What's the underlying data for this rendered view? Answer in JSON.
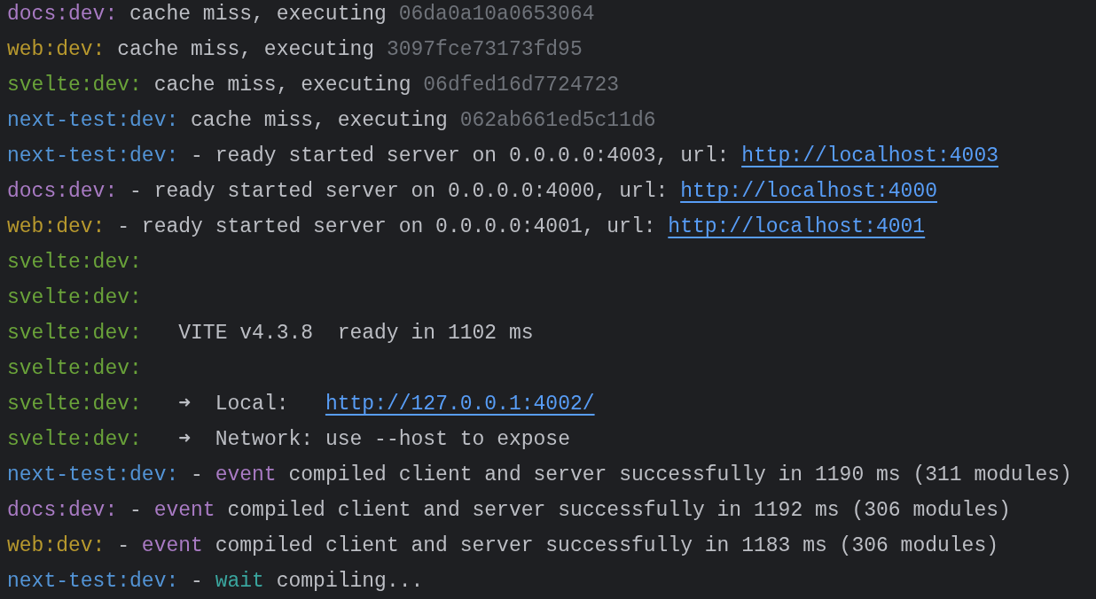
{
  "lines": [
    {
      "segments": [
        {
          "kind": "prefix",
          "text": "docs:dev:",
          "color": "#a97bc4"
        },
        {
          "kind": "text",
          "text": " cache miss, executing "
        },
        {
          "kind": "hash",
          "text": "06da0a10a0653064"
        }
      ]
    },
    {
      "segments": [
        {
          "kind": "prefix",
          "text": "web:dev:",
          "color": "#b8992e"
        },
        {
          "kind": "text",
          "text": " cache miss, executing "
        },
        {
          "kind": "hash",
          "text": "3097fce73173fd95"
        }
      ]
    },
    {
      "segments": [
        {
          "kind": "prefix",
          "text": "svelte:dev:",
          "color": "#6aa33a"
        },
        {
          "kind": "text",
          "text": " cache miss, executing "
        },
        {
          "kind": "hash",
          "text": "06dfed16d7724723"
        }
      ]
    },
    {
      "segments": [
        {
          "kind": "prefix",
          "text": "next-test:dev:",
          "color": "#5394d6"
        },
        {
          "kind": "text",
          "text": " cache miss, executing "
        },
        {
          "kind": "hash",
          "text": "062ab661ed5c11d6"
        }
      ]
    },
    {
      "segments": [
        {
          "kind": "prefix",
          "text": "next-test:dev:",
          "color": "#5394d6"
        },
        {
          "kind": "text",
          "text": " - ready started server on 0.0.0.0:4003, url: "
        },
        {
          "kind": "link",
          "text": "http://localhost:4003"
        }
      ]
    },
    {
      "segments": [
        {
          "kind": "prefix",
          "text": "docs:dev:",
          "color": "#a97bc4"
        },
        {
          "kind": "text",
          "text": " - ready started server on 0.0.0.0:4000, url: "
        },
        {
          "kind": "link",
          "text": "http://localhost:4000"
        }
      ]
    },
    {
      "segments": [
        {
          "kind": "prefix",
          "text": "web:dev:",
          "color": "#b8992e"
        },
        {
          "kind": "text",
          "text": " - ready started server on 0.0.0.0:4001, url: "
        },
        {
          "kind": "link",
          "text": "http://localhost:4001"
        }
      ]
    },
    {
      "segments": [
        {
          "kind": "prefix",
          "text": "svelte:dev:",
          "color": "#6aa33a"
        }
      ]
    },
    {
      "segments": [
        {
          "kind": "prefix",
          "text": "svelte:dev:",
          "color": "#6aa33a"
        }
      ]
    },
    {
      "segments": [
        {
          "kind": "prefix",
          "text": "svelte:dev:",
          "color": "#6aa33a"
        },
        {
          "kind": "text",
          "text": "   VITE v4.3.8  ready in 1102 ms"
        }
      ]
    },
    {
      "segments": [
        {
          "kind": "prefix",
          "text": "svelte:dev:",
          "color": "#6aa33a"
        }
      ]
    },
    {
      "segments": [
        {
          "kind": "prefix",
          "text": "svelte:dev:",
          "color": "#6aa33a"
        },
        {
          "kind": "text",
          "text": "   ➜  Local:   "
        },
        {
          "kind": "link",
          "text": "http://127.0.0.1:4002/"
        }
      ]
    },
    {
      "segments": [
        {
          "kind": "prefix",
          "text": "svelte:dev:",
          "color": "#6aa33a"
        },
        {
          "kind": "text",
          "text": "   ➜  Network: use --host to expose"
        }
      ]
    },
    {
      "segments": [
        {
          "kind": "prefix",
          "text": "next-test:dev:",
          "color": "#5394d6"
        },
        {
          "kind": "text",
          "text": " - "
        },
        {
          "kind": "level",
          "text": "event",
          "color": "#a97bc4"
        },
        {
          "kind": "text",
          "text": " compiled client and server successfully in 1190 ms (311 modules)"
        }
      ]
    },
    {
      "segments": [
        {
          "kind": "prefix",
          "text": "docs:dev:",
          "color": "#a97bc4"
        },
        {
          "kind": "text",
          "text": " - "
        },
        {
          "kind": "level",
          "text": "event",
          "color": "#a97bc4"
        },
        {
          "kind": "text",
          "text": " compiled client and server successfully in 1192 ms (306 modules)"
        }
      ]
    },
    {
      "segments": [
        {
          "kind": "prefix",
          "text": "web:dev:",
          "color": "#b8992e"
        },
        {
          "kind": "text",
          "text": " - "
        },
        {
          "kind": "level",
          "text": "event",
          "color": "#a97bc4"
        },
        {
          "kind": "text",
          "text": " compiled client and server successfully in 1183 ms (306 modules)"
        }
      ]
    },
    {
      "segments": [
        {
          "kind": "prefix",
          "text": "next-test:dev:",
          "color": "#5394d6"
        },
        {
          "kind": "text",
          "text": " - "
        },
        {
          "kind": "level",
          "text": "wait",
          "color": "#3aa69f"
        },
        {
          "kind": "text",
          "text": " compiling..."
        }
      ]
    }
  ]
}
